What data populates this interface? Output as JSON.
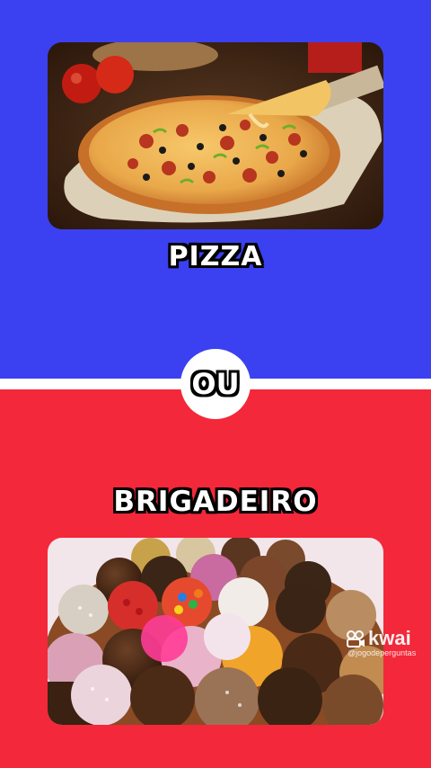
{
  "options": {
    "top": {
      "label": "PIZZA",
      "image": "pizza-photo",
      "background": "#3b41f0"
    },
    "bottom": {
      "label": "BRIGADEIRO",
      "image": "brigadeiro-photo",
      "background": "#f3283a"
    }
  },
  "separator": {
    "label": "OU"
  },
  "watermark": {
    "brand": "kwai",
    "handle": "@jogodeperguntas",
    "icon": "kwai-logo-icon"
  }
}
